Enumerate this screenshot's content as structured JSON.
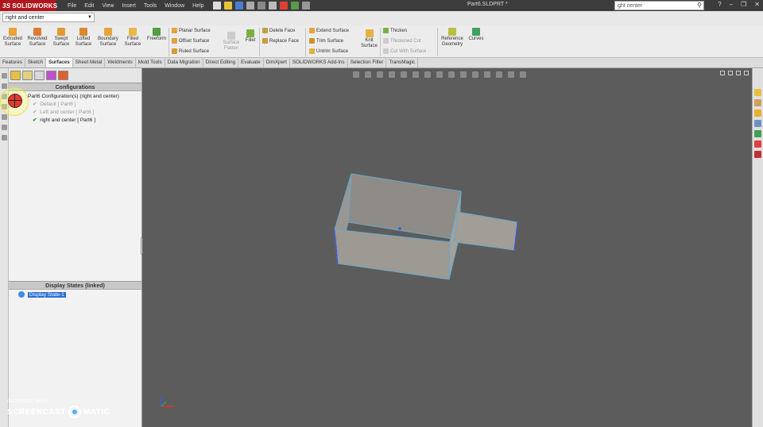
{
  "app": {
    "logo_ds": "3S",
    "logo_name": "SOLIDWORKS",
    "doc_title": "Part6.SLDPRT *",
    "menu": [
      "File",
      "Edit",
      "View",
      "Insert",
      "Tools",
      "Window",
      "Help"
    ],
    "search_text": "ght center",
    "search_icon": "search-icon"
  },
  "config_selector": {
    "value": "right and center"
  },
  "ribbon": {
    "extruded": "Extruded Surface",
    "revolved": "Revolved Surface",
    "swept": "Swept Surface",
    "lofted": "Lofted Surface",
    "boundary": "Boundary Surface",
    "filled": "Filled Surface",
    "freeform": "Freeform",
    "planar": "Planar Surface",
    "offset": "Offset Surface",
    "ruled": "Ruled Surface",
    "surface_flatten": "Surface Flatten",
    "fillet": "Fillet",
    "delete_face": "Delete Face",
    "replace_face": "Replace Face",
    "extend": "Extend Surface",
    "trim": "Trim Surface",
    "untrim": "Untrim Surface",
    "knit": "Knit Surface",
    "thicken": "Thicken",
    "thickened_cut": "Thickened Cut",
    "cut_with_surface": "Cut With Surface",
    "ref_geometry": "Reference Geometry",
    "curves": "Curves"
  },
  "tabs": [
    "Features",
    "Sketch",
    "Surfaces",
    "Sheet Metal",
    "Weldments",
    "Mold Tools",
    "Data Migration",
    "Direct Editing",
    "Evaluate",
    "DimXpert",
    "SOLIDWORKS Add-Ins",
    "Selection Filter",
    "TransMagic"
  ],
  "active_tab": "Surfaces",
  "config_manager": {
    "header": "Configurations",
    "root": "Part6 Configuration(s)  (right and center)",
    "items": [
      {
        "label": "Default [ Part6 ]",
        "active": false
      },
      {
        "label": "Left and center [ Part6 ]",
        "active": false
      },
      {
        "label": "right and center [ Part6 ]",
        "active": true
      }
    ]
  },
  "display_states": {
    "header": "Display States (linked)",
    "items": [
      "Display State-1"
    ]
  },
  "watermark": {
    "top": "RECORDED WITH",
    "left": "SCREENCAST",
    "right": "MATIC"
  },
  "colors": {
    "viewport_bg": "#5c5c5c",
    "model_face": "#9a9690",
    "model_edge": "#66aacc",
    "active_tab": "#f6f6f6",
    "selection": "#2a6fd6"
  }
}
